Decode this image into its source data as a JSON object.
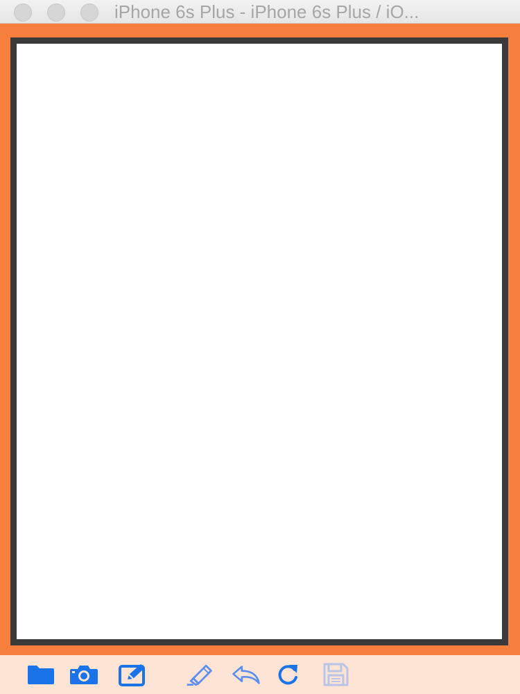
{
  "window": {
    "title": "iPhone 6s Plus - iPhone 6s Plus / iO..."
  },
  "colors": {
    "device_background": "#f77f3e",
    "frame_border": "#3a3a3a",
    "toolbar_background": "#fde4d5",
    "icon_blue": "#1a73e8",
    "icon_disabled": "#b9c4e6"
  },
  "toolbar": {
    "items": [
      {
        "icon": "folder-icon",
        "enabled": true
      },
      {
        "icon": "camera-icon",
        "enabled": true
      },
      {
        "icon": "edit-icon",
        "enabled": true
      },
      {
        "icon": "highlighter-icon",
        "enabled": true
      },
      {
        "icon": "undo-icon",
        "enabled": true
      },
      {
        "icon": "redo-icon",
        "enabled": true
      },
      {
        "icon": "save-icon",
        "enabled": false
      }
    ]
  }
}
